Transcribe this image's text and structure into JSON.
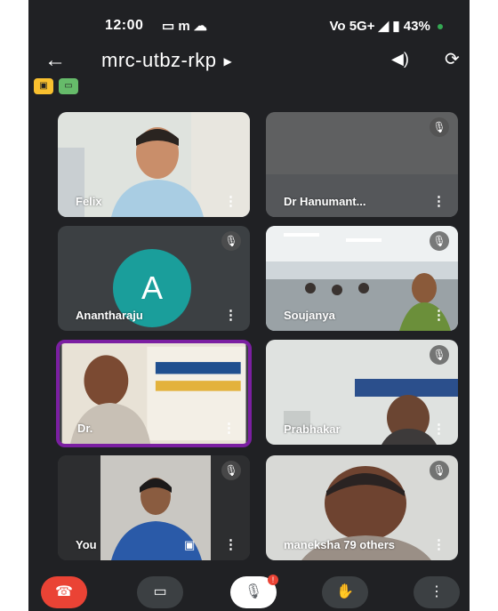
{
  "status_bar": {
    "time": "12:00",
    "left_icons": "▭ m ☁",
    "network": "Vo 5G+",
    "battery": "43%"
  },
  "meeting": {
    "code": "mrc-utbz-rkp"
  },
  "icons": {
    "back": "arrow-left",
    "speaker": "speaker",
    "switch_camera": "camera-switch",
    "mute": "mic-off",
    "more": "vertical-dots"
  },
  "participants": [
    {
      "name": "Felix",
      "muted": false
    },
    {
      "name": "Dr Hanumant...",
      "muted": true
    },
    {
      "name": "Anantharaju",
      "muted": true,
      "avatar_letter": "A"
    },
    {
      "name": "Soujanya",
      "muted": true
    },
    {
      "name": "Dr.",
      "muted": false,
      "active_speaker": true
    },
    {
      "name": "Prabhakar",
      "muted": true
    },
    {
      "name": "You",
      "muted": true
    },
    {
      "name": "maneksha",
      "muted": true
    }
  ],
  "others_count": "79 others",
  "controls": {
    "mic_badge": "!"
  },
  "colors": {
    "background": "#202124",
    "end_call": "#ea4335",
    "active_border": "#7b1fa2",
    "avatar": "#1a9e9b"
  }
}
